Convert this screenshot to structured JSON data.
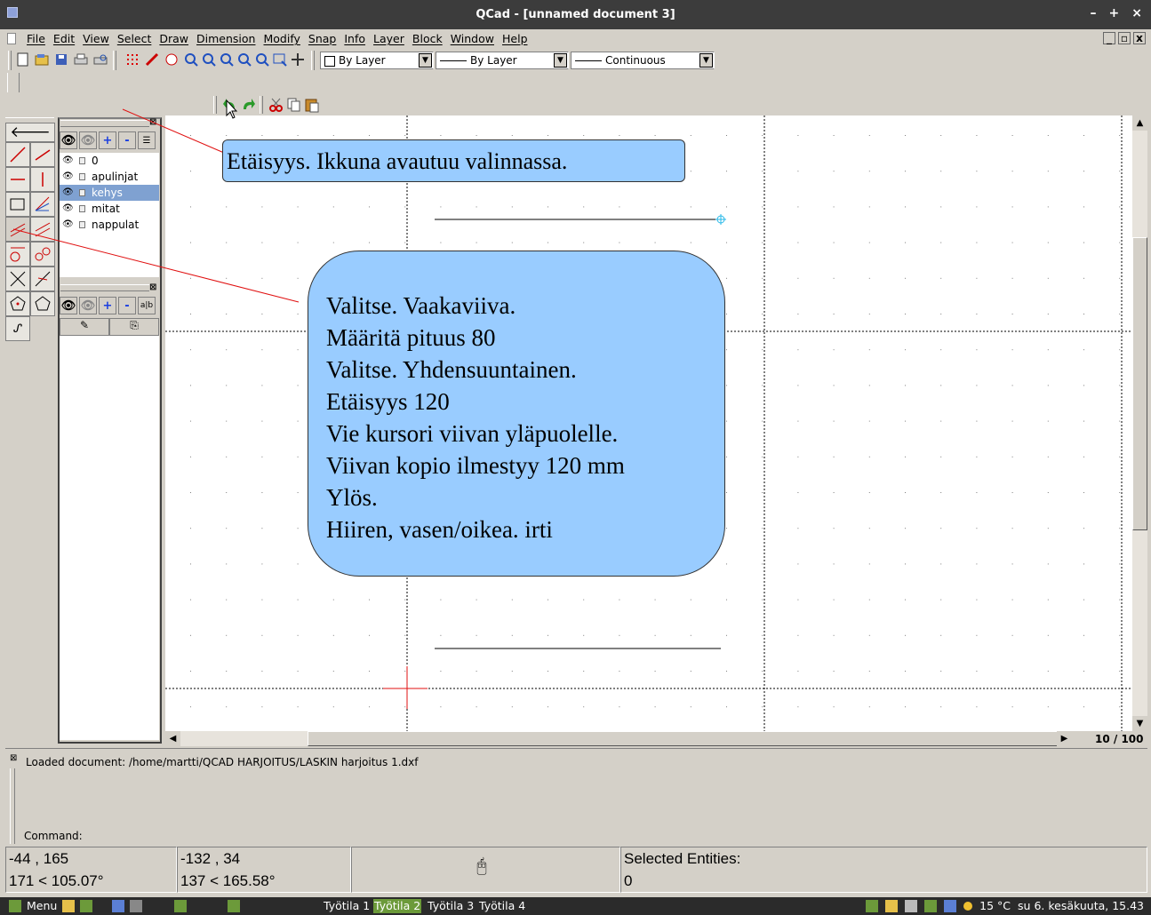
{
  "window": {
    "title": "QCad - [unnamed document 3]",
    "controls": [
      "–",
      "+",
      "×"
    ]
  },
  "menu": {
    "items": [
      "File",
      "Edit",
      "View",
      "Select",
      "Draw",
      "Dimension",
      "Modify",
      "Snap",
      "Info",
      "Layer",
      "Block",
      "Window",
      "Help"
    ],
    "mdi_controls": [
      "_",
      "▫",
      "x"
    ]
  },
  "toolbar": {
    "color_combo": "By Layer",
    "width_combo": "By Layer",
    "linetype_combo": "Continuous"
  },
  "layers": {
    "items": [
      {
        "name": "0",
        "selected": false
      },
      {
        "name": "apulinjat",
        "selected": false
      },
      {
        "name": "kehys",
        "selected": true
      },
      {
        "name": "mitat",
        "selected": false
      },
      {
        "name": "nappulat",
        "selected": false
      }
    ],
    "add_label": "+",
    "remove_label": "-"
  },
  "blocks": {
    "add_label": "+",
    "remove_label": "-",
    "text_btn": "a|b"
  },
  "callouts": {
    "top": "Etäisyys. Ikkuna avautuu valinnassa.",
    "main": [
      "Valitse. Vaakaviiva.",
      "Määritä pituus 80",
      "Valitse. Yhdensuuntainen.",
      "Etäisyys 120",
      "Vie kursori viivan yläpuolelle.",
      "Viivan kopio ilmestyy 120 mm",
      "Ylös.",
      "Hiiren, vasen/oikea. irti"
    ]
  },
  "zoom_label": "10 / 100",
  "output": {
    "message": "Loaded document: /home/martti/QCAD HARJOITUS/LASKIN harjoitus 1.dxf",
    "command_label": "Command:"
  },
  "status": {
    "abs_coord": "-44 , 165",
    "abs_polar": "171 < 105.07°",
    "rel_coord": "-132 , 34",
    "rel_polar": "137 < 165.58°",
    "selected_label": "Selected Entities:",
    "selected_count": "0"
  },
  "taskbar": {
    "menu_label": "Menu",
    "workspaces": [
      {
        "label": "Työtila 1",
        "active": false
      },
      {
        "label": "Työtila 2",
        "active": true
      },
      {
        "label": "Työtila 3",
        "active": false
      },
      {
        "label": "Työtila 4",
        "active": false
      }
    ],
    "weather": "15 °C",
    "datetime": "su  6. kesäkuuta, 15.43"
  },
  "colors": {
    "callout_fill": "#99ccff",
    "annotation_line": "#e01010",
    "titlebar": "#3c3c3c",
    "layer_selected": "#7fa1d1"
  }
}
